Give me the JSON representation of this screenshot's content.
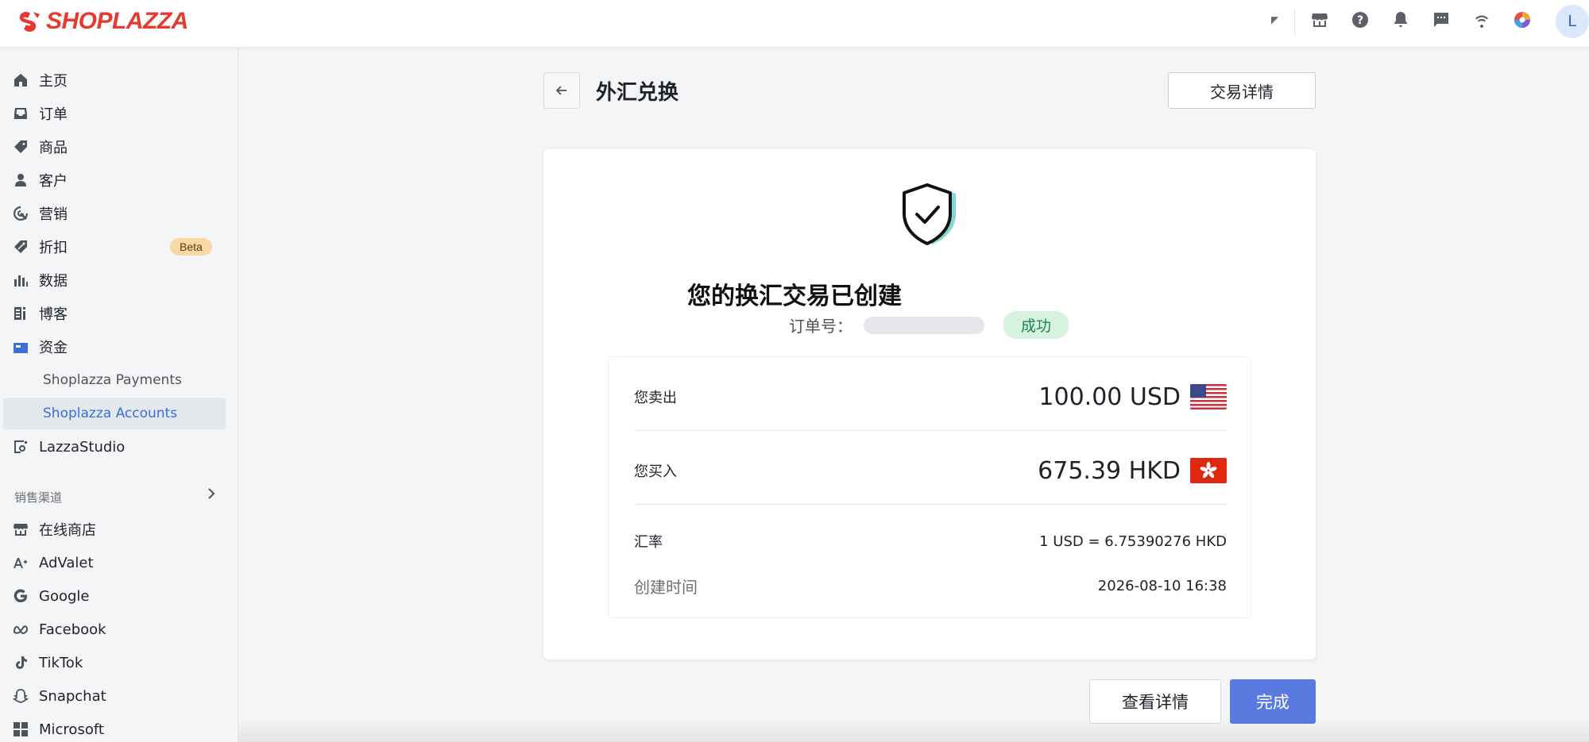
{
  "brand": {
    "name": "SHOPLAZZA",
    "color": "#e8382f"
  },
  "topbar": {
    "icons": [
      "caret-icon",
      "store-icon",
      "help-icon",
      "bell-icon",
      "chat-icon",
      "wifi-icon",
      "color-wheel-icon"
    ],
    "avatar_initial": "L"
  },
  "sidebar": {
    "items": [
      {
        "label": "主页",
        "icon": "home-icon"
      },
      {
        "label": "订单",
        "icon": "inbox-icon"
      },
      {
        "label": "商品",
        "icon": "tag-icon"
      },
      {
        "label": "客户",
        "icon": "person-icon"
      },
      {
        "label": "营销",
        "icon": "target-icon"
      },
      {
        "label": "折扣",
        "icon": "discount-icon",
        "badge": "Beta"
      },
      {
        "label": "数据",
        "icon": "bar-chart-icon"
      },
      {
        "label": "博客",
        "icon": "blog-icon"
      },
      {
        "label": "资金",
        "icon": "wallet-icon"
      },
      {
        "label": "Shoplazza Payments",
        "sub": true
      },
      {
        "label": "Shoplazza Accounts",
        "sub": true,
        "active": true
      },
      {
        "label": "LazzaStudio",
        "icon": "studio-icon"
      }
    ],
    "section_label": "销售渠道",
    "channels": [
      {
        "label": "在线商店",
        "icon": "store-icon"
      },
      {
        "label": "AdValet",
        "icon": "advalet-icon"
      },
      {
        "label": "Google",
        "icon": "google-icon"
      },
      {
        "label": "Facebook",
        "icon": "meta-icon"
      },
      {
        "label": "TikTok",
        "icon": "tiktok-icon"
      },
      {
        "label": "Snapchat",
        "icon": "snapchat-icon"
      },
      {
        "label": "Microsoft",
        "icon": "microsoft-icon"
      }
    ]
  },
  "header": {
    "title": "外汇兑换",
    "detail_button": "交易详情"
  },
  "result": {
    "title": "您的换汇交易已创建",
    "order_label": "订单号：",
    "status": "成功",
    "sell_label": "您卖出",
    "sell_amount": "100.00 USD",
    "buy_label": "您买入",
    "buy_amount": "675.39 HKD",
    "rate_label": "汇率",
    "rate_value": "1 USD = 6.75390276 HKD",
    "created_label": "创建时间",
    "created_value": "2026-08-10 16:38"
  },
  "actions": {
    "view_details": "查看详情",
    "done": "完成"
  },
  "colors": {
    "primary": "#5a7ae0",
    "success_bg": "#d7f2e1",
    "success_text": "#17884a",
    "beta_bg": "#fcd7a6"
  }
}
